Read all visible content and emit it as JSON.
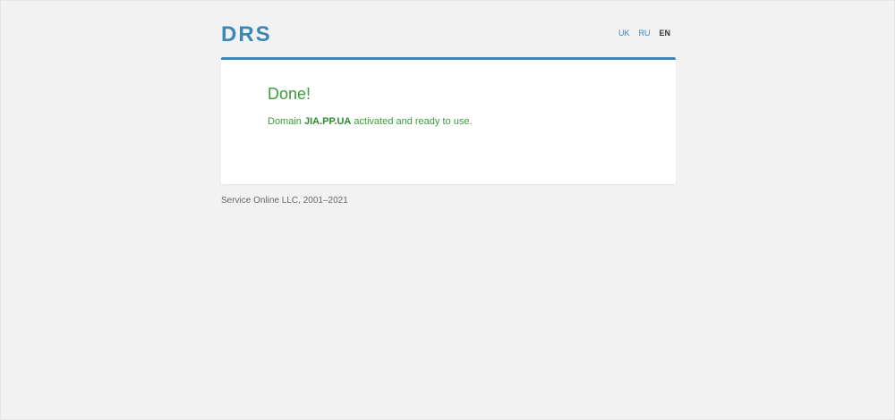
{
  "header": {
    "logo": "DRS",
    "languages": [
      {
        "label": "UK",
        "active": false
      },
      {
        "label": "RU",
        "active": false
      },
      {
        "label": "EN",
        "active": true
      }
    ]
  },
  "card": {
    "title": "Done!",
    "message_prefix": "Domain",
    "domain": "JIA.PP.UA",
    "message_suffix": "activated and ready to use."
  },
  "footer": {
    "copyright": "Service Online LLC, 2001–2021"
  },
  "colors": {
    "brand": "#3a87b8",
    "success": "#3b9a3b",
    "background": "#f2f2f2"
  }
}
